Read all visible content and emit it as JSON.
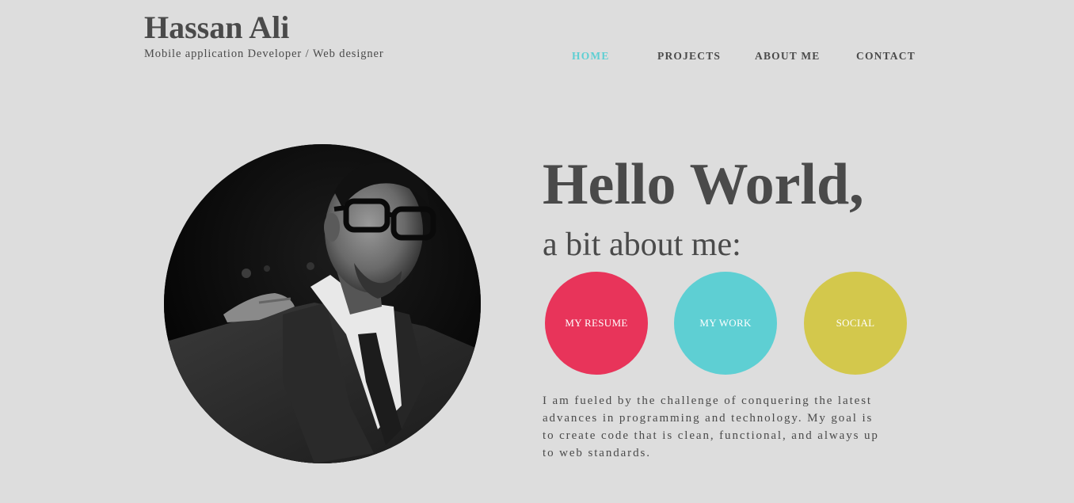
{
  "header": {
    "name": "Hassan Ali",
    "tagline": "Mobile application Developer / Web designer"
  },
  "nav": {
    "items": [
      {
        "label": "HOME",
        "active": true
      },
      {
        "label": "PROJECTS",
        "active": false
      },
      {
        "label": "ABOUT ME",
        "active": false
      },
      {
        "label": "CONTACT",
        "active": false
      }
    ]
  },
  "hero": {
    "title": "Hello World,",
    "subtitle": "a bit about me:"
  },
  "buttons": [
    {
      "label": "MY RESUME",
      "color": "#e8345a"
    },
    {
      "label": "MY WORK",
      "color": "#5ecfd3"
    },
    {
      "label": "SOCIAL",
      "color": "#d3c84c"
    }
  ],
  "bio": {
    "line1": "I am fueled by the challenge of conquering the latest",
    "line2": "advances in programming and technology. My goal is",
    "line3": "to create code that is clean, functional, and always up",
    "line4": "to web standards."
  },
  "colors": {
    "background": "#dddddd",
    "text": "#4a4a4a",
    "accent": "#5ecfd3"
  },
  "portrait": {
    "icon": "profile-photo"
  }
}
